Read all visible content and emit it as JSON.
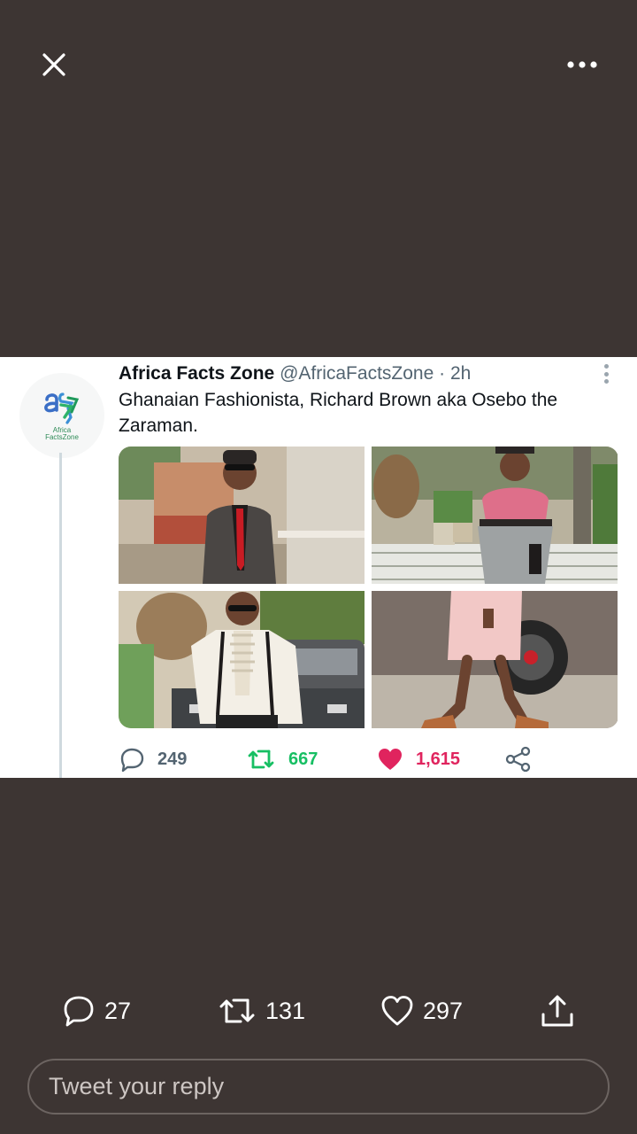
{
  "viewer": {
    "close_icon": "close-icon",
    "more_icon": "more-horizontal-icon"
  },
  "embedded_tweet": {
    "avatar_icon": "africa-facts-zone-logo",
    "avatar_caption": "Africa\nFactsZone",
    "author_name": "Africa Facts Zone",
    "author_handle": "@AfricaFactsZone",
    "separator": "·",
    "time": "2h",
    "text": "Ghanaian Fashionista, Richard Brown aka Osebo the Zaraman.",
    "photos": [
      "photo-1",
      "photo-2",
      "photo-3",
      "photo-4"
    ],
    "replies": "249",
    "retweets": "667",
    "likes": "1,615",
    "colors": {
      "retweet": "#17bf63",
      "like": "#e0245e",
      "muted": "#536471"
    }
  },
  "actions": {
    "replies": "27",
    "retweets": "131",
    "likes": "297"
  },
  "reply": {
    "placeholder": "Tweet your reply"
  },
  "theme": {
    "background": "#3d3533",
    "foreground": "#ffffff"
  }
}
